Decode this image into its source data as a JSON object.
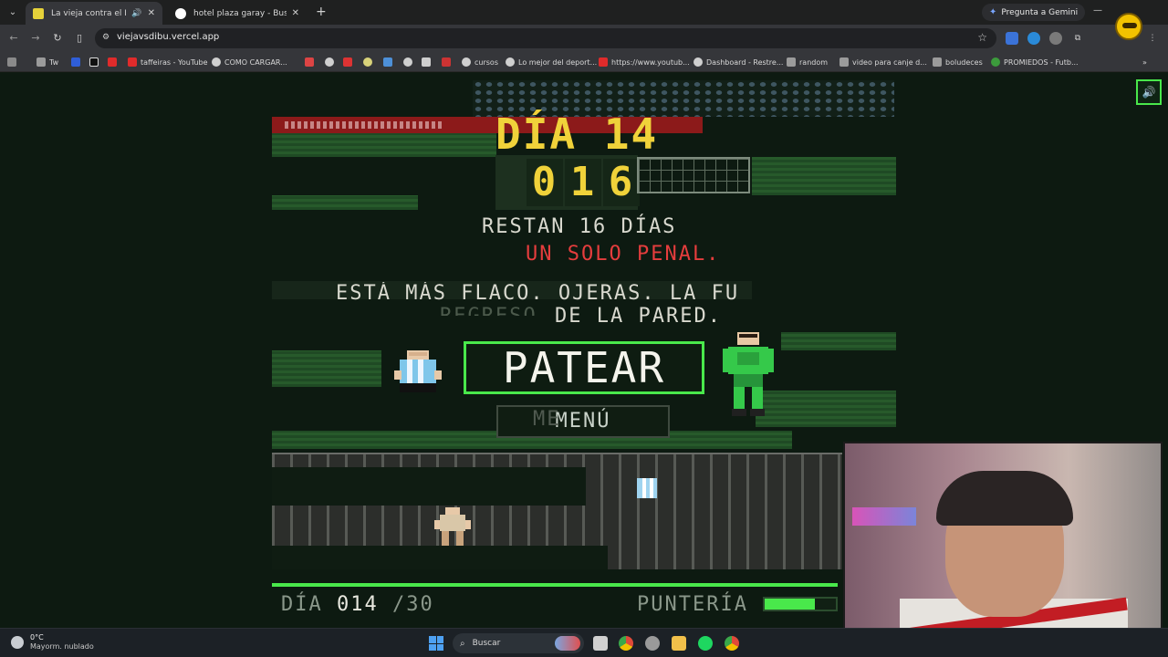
{
  "browser": {
    "tabs": [
      {
        "title": "La vieja contra el Dibu",
        "active": true,
        "favicon_color": "#e6d23a"
      },
      {
        "title": "hotel plaza garay - Buscar con",
        "active": false,
        "favicon_color": "#4285f4"
      }
    ],
    "gemini_label": "Pregunta a Gemini",
    "url": "viejavsdibu.vercel.app",
    "bookmarks": [
      "Tw",
      "taffeiras - YouTube",
      "COMO CARGAR...",
      "cursos",
      "Lo mejor del deport...",
      "https://www.youtub...",
      "Dashboard - Restre...",
      "random",
      "video para canje d...",
      "boludeces",
      "PROMIEDOS - Futb..."
    ]
  },
  "game": {
    "day_title": "DÍA 14",
    "countdown_digits": [
      "0",
      "1",
      "6"
    ],
    "remaining_text": "RESTAN 16 DÍAS",
    "penal_text": "UN SOLO PENAL.",
    "story_line1": "ESTÁ MÁS FLACO. OJERAS. LA FU",
    "story_line2": "DE LA PARED.",
    "story_line2_ghost": "REGRESO",
    "kick_button": "PATEAR",
    "menu_button": "MENÚ",
    "menu_ghost": "ME",
    "hud": {
      "day_label": "DÍA",
      "day_value": "014",
      "day_total": "/30",
      "aim_label": "PUNTERÍA",
      "aim_level": 0.7
    },
    "accent_color": "#49e84b",
    "title_color": "#f0d23a",
    "alert_color": "#e53d3d"
  },
  "taskbar": {
    "temperature": "0°C",
    "weather": "Mayorm. nublado",
    "search_placeholder": "Buscar"
  }
}
